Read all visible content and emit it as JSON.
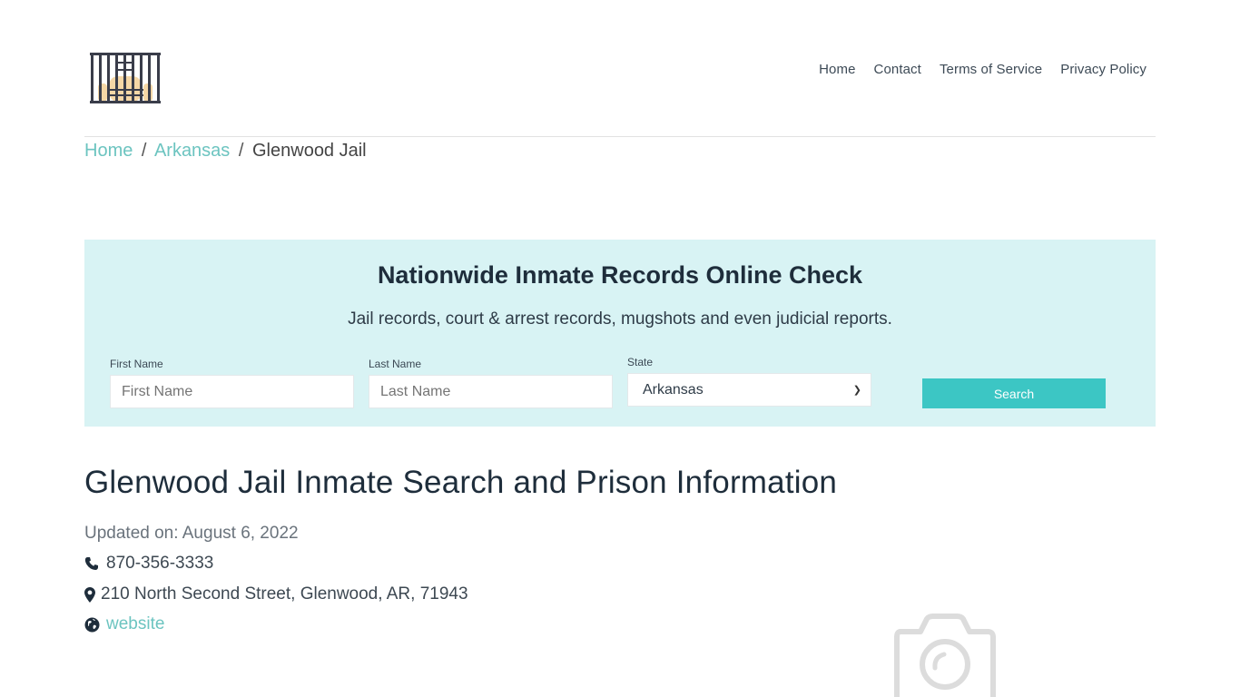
{
  "header": {
    "logo_icon": "jail-bars-logo-icon",
    "nav": [
      {
        "label": "Home"
      },
      {
        "label": "Contact"
      },
      {
        "label": "Terms of Service"
      },
      {
        "label": "Privacy Policy"
      }
    ]
  },
  "breadcrumb": {
    "items": [
      {
        "label": "Home",
        "link": true
      },
      {
        "label": "Arkansas",
        "link": true
      },
      {
        "label": "Glenwood Jail",
        "link": false
      }
    ],
    "separator": "/"
  },
  "search": {
    "title": "Nationwide Inmate Records Online Check",
    "subtitle": "Jail records, court & arrest records, mugshots and even judicial reports.",
    "first_name": {
      "label": "First Name",
      "placeholder": "First Name",
      "value": ""
    },
    "last_name": {
      "label": "Last Name",
      "placeholder": "Last Name",
      "value": ""
    },
    "state": {
      "label": "State",
      "selected": "Arkansas"
    },
    "button_label": "Search",
    "colors": {
      "panel_bg": "#d8f3f4",
      "button": "#3cc6c4",
      "link": "#6cc4c0"
    }
  },
  "main": {
    "title": "Glenwood Jail Inmate Search and Prison Information",
    "updated": "Updated on: August 6, 2022",
    "phone": "870-356-3333",
    "address": "210 North Second Street, Glenwood, AR, 71943",
    "website_label": "website",
    "image_placeholder_icon": "camera-icon"
  }
}
